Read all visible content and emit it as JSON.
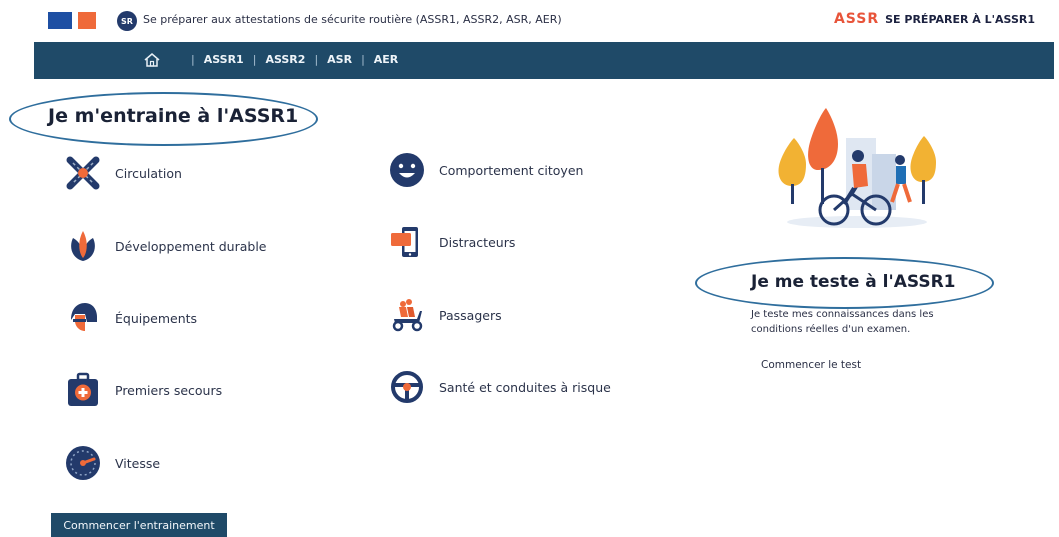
{
  "header": {
    "site_logo_text": "SR",
    "site_title": "Se préparer aux attestations de sécurite routière (ASSR1, ASSR2, ASR, AER)",
    "brand_mark": "ASSR",
    "brand_text": "SE PRÉPARER À L'ASSR1"
  },
  "nav": {
    "separator": "|",
    "items": [
      "ASSR1",
      "ASSR2",
      "ASR",
      "AER"
    ]
  },
  "training": {
    "title": "Je m'entraine à l'ASSR1",
    "topics": [
      {
        "label": "Circulation",
        "icon": "crossroads-icon"
      },
      {
        "label": "Comportement citoyen",
        "icon": "smiley-icon"
      },
      {
        "label": "Développement durable",
        "icon": "leaves-icon"
      },
      {
        "label": "Distracteurs",
        "icon": "phone-icon"
      },
      {
        "label": "Équipements",
        "icon": "helmet-icon"
      },
      {
        "label": "Passagers",
        "icon": "scooter-icon"
      },
      {
        "label": "Premiers secours",
        "icon": "first-aid-kit-icon"
      },
      {
        "label": "Santé et conduites à risque",
        "icon": "steering-wheel-icon"
      },
      {
        "label": "Vitesse",
        "icon": "speedometer-icon"
      }
    ],
    "button_label": "Commencer l'entrainement"
  },
  "test": {
    "title": "Je me teste à l'ASSR1",
    "description": "Je teste mes connaissances dans les conditions réelles d'un examen.",
    "link_label": "Commencer le test"
  },
  "colors": {
    "nav_bg": "#1f4a68",
    "accent_orange": "#ef6a3a",
    "navy": "#233a6b",
    "annotation_ring": "#2f6e9d"
  }
}
